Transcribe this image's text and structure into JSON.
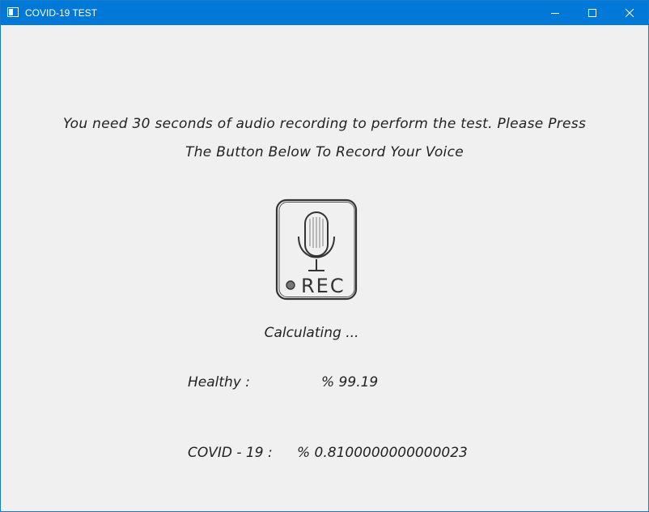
{
  "window": {
    "title": "COVID-19 TEST",
    "controls": [
      "minimize",
      "maximize",
      "close"
    ]
  },
  "instructions": {
    "line1": "You need 30 seconds of audio recording to perform the test. Please Press",
    "line2": "The Button Below To Record Your Voice"
  },
  "record_button": {
    "label": "REC",
    "icon": "microphone-icon"
  },
  "status": "Calculating ...",
  "results": {
    "healthy_label": "Healthy :",
    "healthy_value": "% 99.19",
    "covid_label": "COVID - 19 :",
    "covid_value": "% 0.8100000000000023"
  },
  "colors": {
    "titlebar": "#0078d7",
    "background": "#f0f0f0",
    "text": "#222222"
  }
}
